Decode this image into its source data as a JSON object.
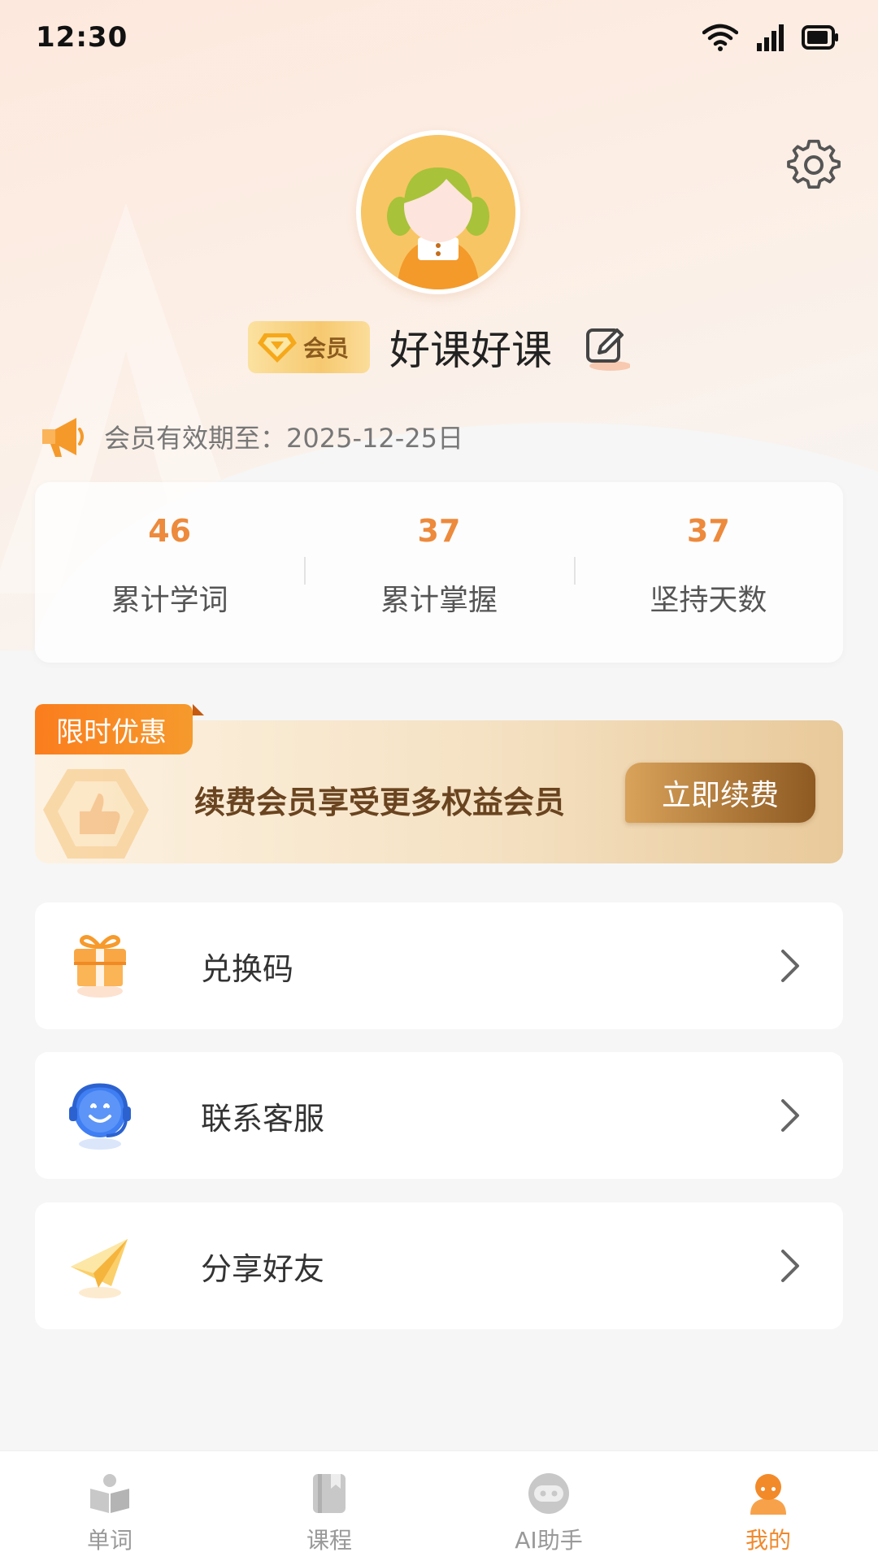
{
  "status_bar": {
    "time": "12:30"
  },
  "profile": {
    "badge_label": "会员",
    "username": "好课好课",
    "membership_expiry": "会员有效期至：2025-12-25日"
  },
  "stats": [
    {
      "value": "46",
      "label": "累计学词"
    },
    {
      "value": "37",
      "label": "累计掌握"
    },
    {
      "value": "37",
      "label": "坚持天数"
    }
  ],
  "promo": {
    "tag": "限时优惠",
    "text": "续费会员享受更多权益会员",
    "button": "立即续费"
  },
  "menu": [
    {
      "label": "兑换码",
      "icon": "gift-icon"
    },
    {
      "label": "联系客服",
      "icon": "customer-service-icon"
    },
    {
      "label": "分享好友",
      "icon": "paper-plane-icon"
    }
  ],
  "tabs": [
    {
      "label": "单词",
      "icon": "book-open-icon",
      "active": false
    },
    {
      "label": "课程",
      "icon": "notebook-icon",
      "active": false
    },
    {
      "label": "AI助手",
      "icon": "chat-bubble-icon",
      "active": false
    },
    {
      "label": "我的",
      "icon": "user-icon",
      "active": true
    }
  ],
  "colors": {
    "accent": "#f0892c",
    "stat_value": "#ed8a3c",
    "promo_button": "#b07a3b"
  }
}
